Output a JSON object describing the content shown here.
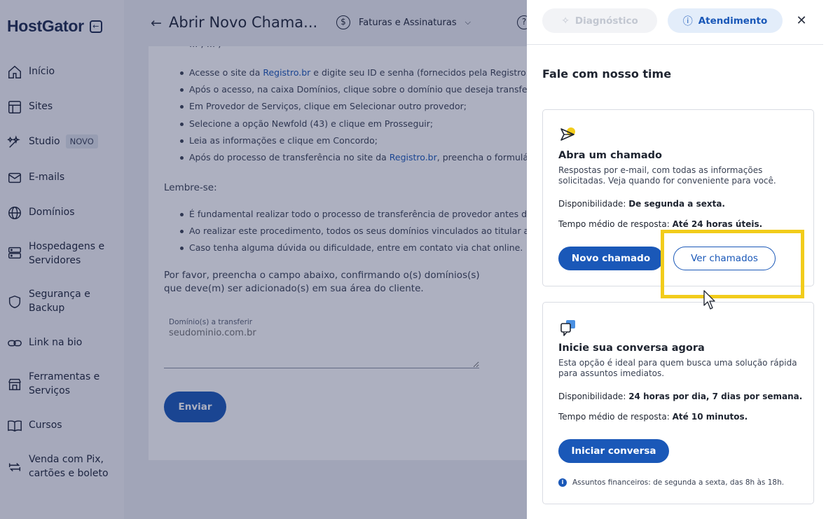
{
  "sidebar": {
    "brand": "HostGator",
    "items": [
      {
        "label": "Início"
      },
      {
        "label": "Sites"
      },
      {
        "label": "Studio",
        "badge": "NOVO"
      },
      {
        "label": "E-mails"
      },
      {
        "label": "Domínios"
      },
      {
        "label": "Hospedagens e Servidores"
      },
      {
        "label": "Segurança e Backup"
      },
      {
        "label": "Link na bio"
      },
      {
        "label": "Ferramentas e Serviços"
      },
      {
        "label": "Cursos"
      },
      {
        "label": "Venda com Pix, cartões e boleto"
      }
    ]
  },
  "header": {
    "title": "Abrir Novo Chama...",
    "billing_label": "Faturas e Assinaturas"
  },
  "form": {
    "top_cut": "... ,  ... ,",
    "steps": [
      {
        "pre": "Acesse o site da ",
        "link": "Registro.br",
        "post": " e digite seu ID e senha (fornecidos pela Registro.br);"
      },
      {
        "pre": "Após o acesso, na caixa Domínios, clique sobre o domínio que deseja transferir;",
        "link": "",
        "post": ""
      },
      {
        "pre": "Em Provedor de Serviços, clique em Selecionar outro provedor;",
        "link": "",
        "post": ""
      },
      {
        "pre": "Selecione a opção Newfold (43) e clique em Prosseguir;",
        "link": "",
        "post": ""
      },
      {
        "pre": "Leia as informações e clique em Concordo;",
        "link": "",
        "post": ""
      },
      {
        "pre": "Após do processo de transferência no site da ",
        "link": "Registro.br",
        "post": ", preencha o formulário abaixo."
      }
    ],
    "remember": "Lembre-se:",
    "notes": [
      "É fundamental realizar todo o processo de transferência de provedor antes de enviar o formulário;",
      "Ao realizar este procedimento, todos os seus domínios vinculados ao titular alterado serão transferidos;",
      "Caso tenha alguma dúvida ou dificuldade, entre em contato via chat online."
    ],
    "paragraph": "Por favor, preencha o campo abaixo, confirmando o(s) domínios(s) que deve(m) ser adicionado(s) em sua área do cliente.",
    "field_label": "Domínio(s) a transferir",
    "field_placeholder": "seudominio.com.br",
    "submit": "Enviar"
  },
  "panel": {
    "tabs": {
      "diagnostico": "Diagnóstico",
      "atendimento": "Atendimento"
    },
    "title": "Fale com nosso time",
    "ticket": {
      "title": "Abra um chamado",
      "desc": "Respostas por e-mail, com todas as informações solicitadas. Veja quando for conveniente para você.",
      "availability_label": "Disponibilidade:",
      "availability_value": "De segunda a sexta.",
      "response_label": "Tempo médio de resposta:",
      "response_value": "Até 24 horas úteis.",
      "new_btn": "Novo chamado",
      "view_btn": "Ver chamados"
    },
    "chat": {
      "title": "Inicie sua conversa agora",
      "desc": "Esta opção é ideal para quem busca uma solução rápida para assuntos imediatos.",
      "availability_label": "Disponibilidade:",
      "availability_value": "24 horas por dia, 7 dias por semana.",
      "response_label": "Tempo médio de resposta:",
      "response_value": "Até 10 minutos.",
      "start_btn": "Iniciar conversa",
      "info": "Assuntos financeiros: de segunda a sexta, das 8h às 18h."
    }
  },
  "colors": {
    "primary": "#1a58b8",
    "highlight": "#f2cc1b",
    "sidebar_bg": "#f4f5f8"
  }
}
